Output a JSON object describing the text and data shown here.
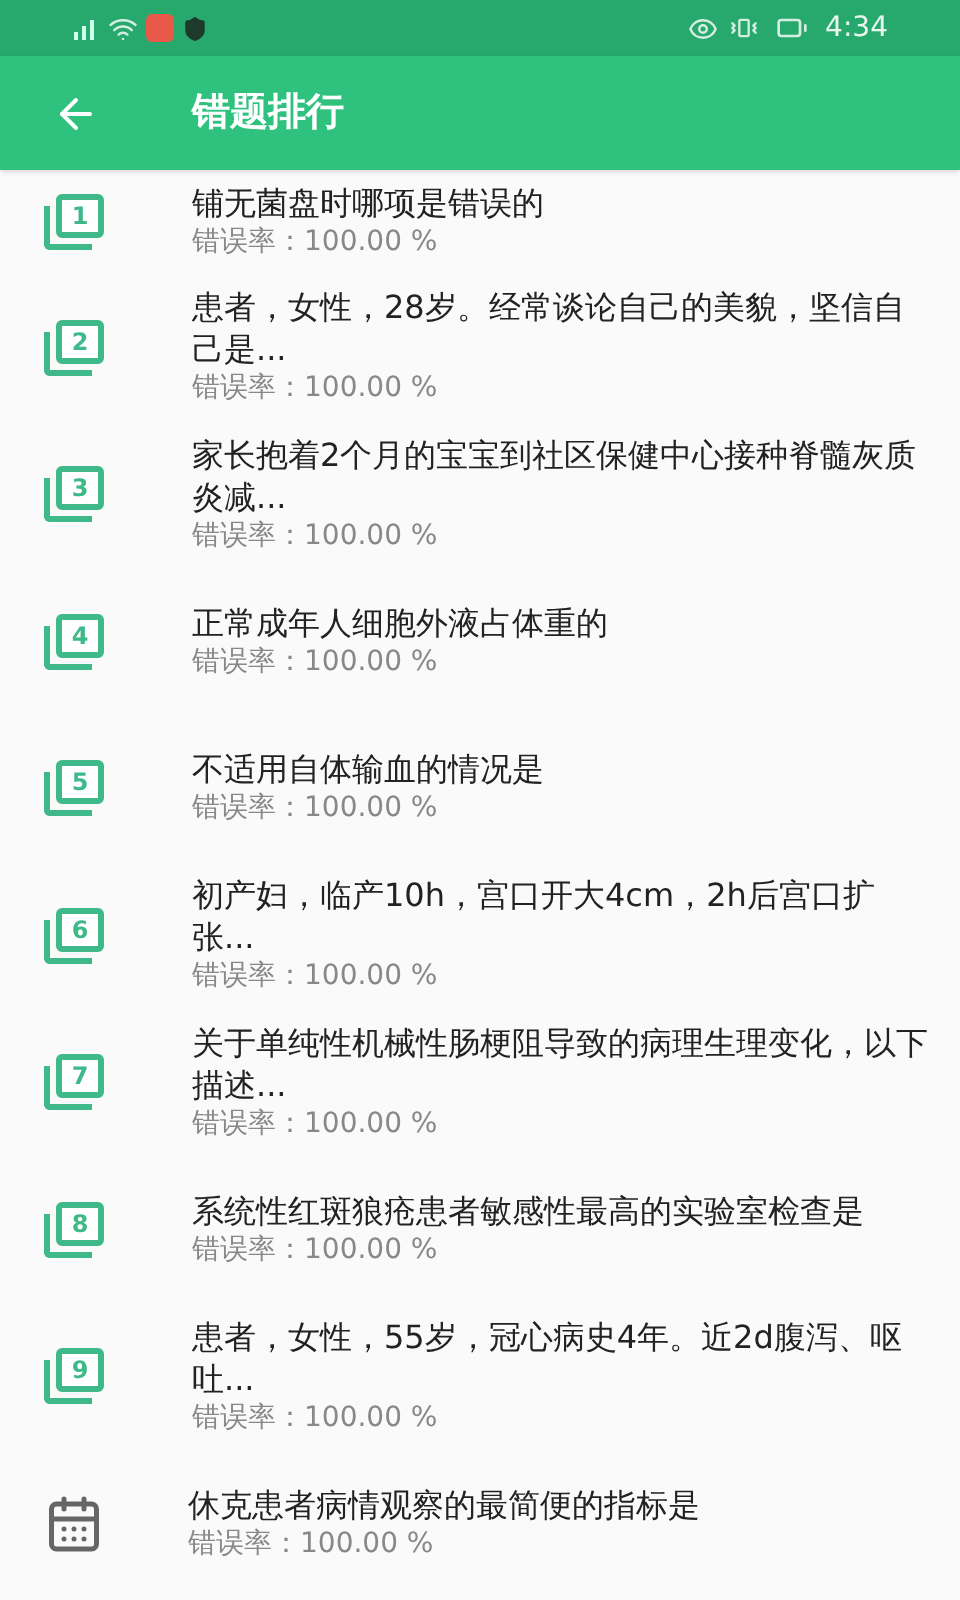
{
  "status_bar": {
    "time": "4:34"
  },
  "app_bar": {
    "title": "错题排行"
  },
  "items": [
    {
      "kind": "numbered",
      "number": "1",
      "title": "铺无菌盘时哪项是错误的",
      "rate": "错误率：100.00 %"
    },
    {
      "kind": "numbered",
      "number": "2",
      "title": "患者，女性，28岁。经常谈论自己的美貌，坚信自己是...",
      "rate": "错误率：100.00 %"
    },
    {
      "kind": "numbered",
      "number": "3",
      "title": "家长抱着2个月的宝宝到社区保健中心接种脊髓灰质炎减...",
      "rate": "错误率：100.00 %"
    },
    {
      "kind": "numbered",
      "number": "4",
      "title": "正常成年人细胞外液占体重的",
      "rate": "错误率：100.00 %"
    },
    {
      "kind": "numbered",
      "number": "5",
      "title": "不适用自体输血的情况是",
      "rate": "错误率：100.00 %"
    },
    {
      "kind": "numbered",
      "number": "6",
      "title": "初产妇，临产10h，宫口开大4cm，2h后宫口扩张...",
      "rate": "错误率：100.00 %"
    },
    {
      "kind": "numbered",
      "number": "7",
      "title": "关于单纯性机械性肠梗阻导致的病理生理变化，以下描述...",
      "rate": "错误率：100.00 %"
    },
    {
      "kind": "numbered",
      "number": "8",
      "title": "系统性红斑狼疮患者敏感性最高的实验室检查是",
      "rate": "错误率：100.00 %"
    },
    {
      "kind": "numbered",
      "number": "9",
      "title": "患者，女性，55岁，冠心病史4年。近2d腹泻、呕吐...",
      "rate": "错误率：100.00 %"
    },
    {
      "kind": "note",
      "title": "休克患者病情观察的最简便的指标是",
      "rate": "错误率：100.00 %"
    }
  ]
}
